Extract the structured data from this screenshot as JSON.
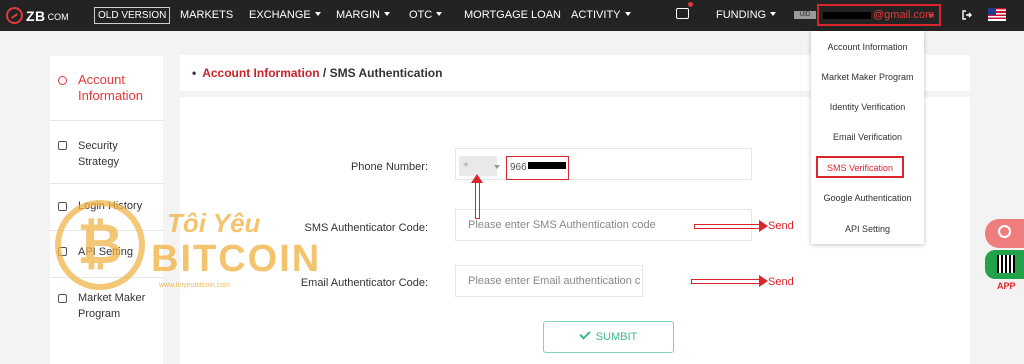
{
  "nav": {
    "logo": "ZB",
    "logo_suffix": "COM",
    "old_version": "OLD VERSION",
    "items": [
      "MARKETS",
      "EXCHANGE",
      "MARGIN",
      "OTC",
      "MORTGAGE LOAN",
      "ACTIVITY"
    ],
    "funding": "FUNDING",
    "uid_tag": "UID",
    "account_email": "@gmail.com"
  },
  "sidebar": {
    "items": [
      {
        "label": "Account Information",
        "active": true
      },
      {
        "label": "Security Strategy",
        "active": false
      },
      {
        "label": "Login History",
        "active": false
      },
      {
        "label": "API Setting",
        "active": false
      },
      {
        "label": "Market Maker Program",
        "active": false
      }
    ]
  },
  "breadcrumb": {
    "parent": "Account Information",
    "separator": "/",
    "current": "SMS Authentication"
  },
  "form": {
    "phone_label": "Phone Number:",
    "country_code": "+",
    "phone_value": "966",
    "sms_label": "SMS Authenticator Code:",
    "sms_placeholder": "Please enter SMS Authentication code",
    "email_label": "Email Authenticator Code:",
    "email_placeholder": "Please enter Email authentication c",
    "send_label": "Send",
    "submit_label": "SUMBIT"
  },
  "dropdown": {
    "items": [
      "Account Information",
      "Market Maker Program",
      "Identity Verification",
      "Email Verification",
      "SMS Verification",
      "Google Authentication",
      "API Setting"
    ],
    "selected_index": 4
  },
  "floating": {
    "app_label": "APP"
  },
  "watermark": {
    "title_line1": "Tôi Yêu",
    "title_line2": "BITCOIN",
    "site": "www.toiyeubitcoin.com"
  },
  "colors": {
    "accent": "#d9262b",
    "submit_green": "#3cb98c",
    "app_green": "#22a34a"
  }
}
